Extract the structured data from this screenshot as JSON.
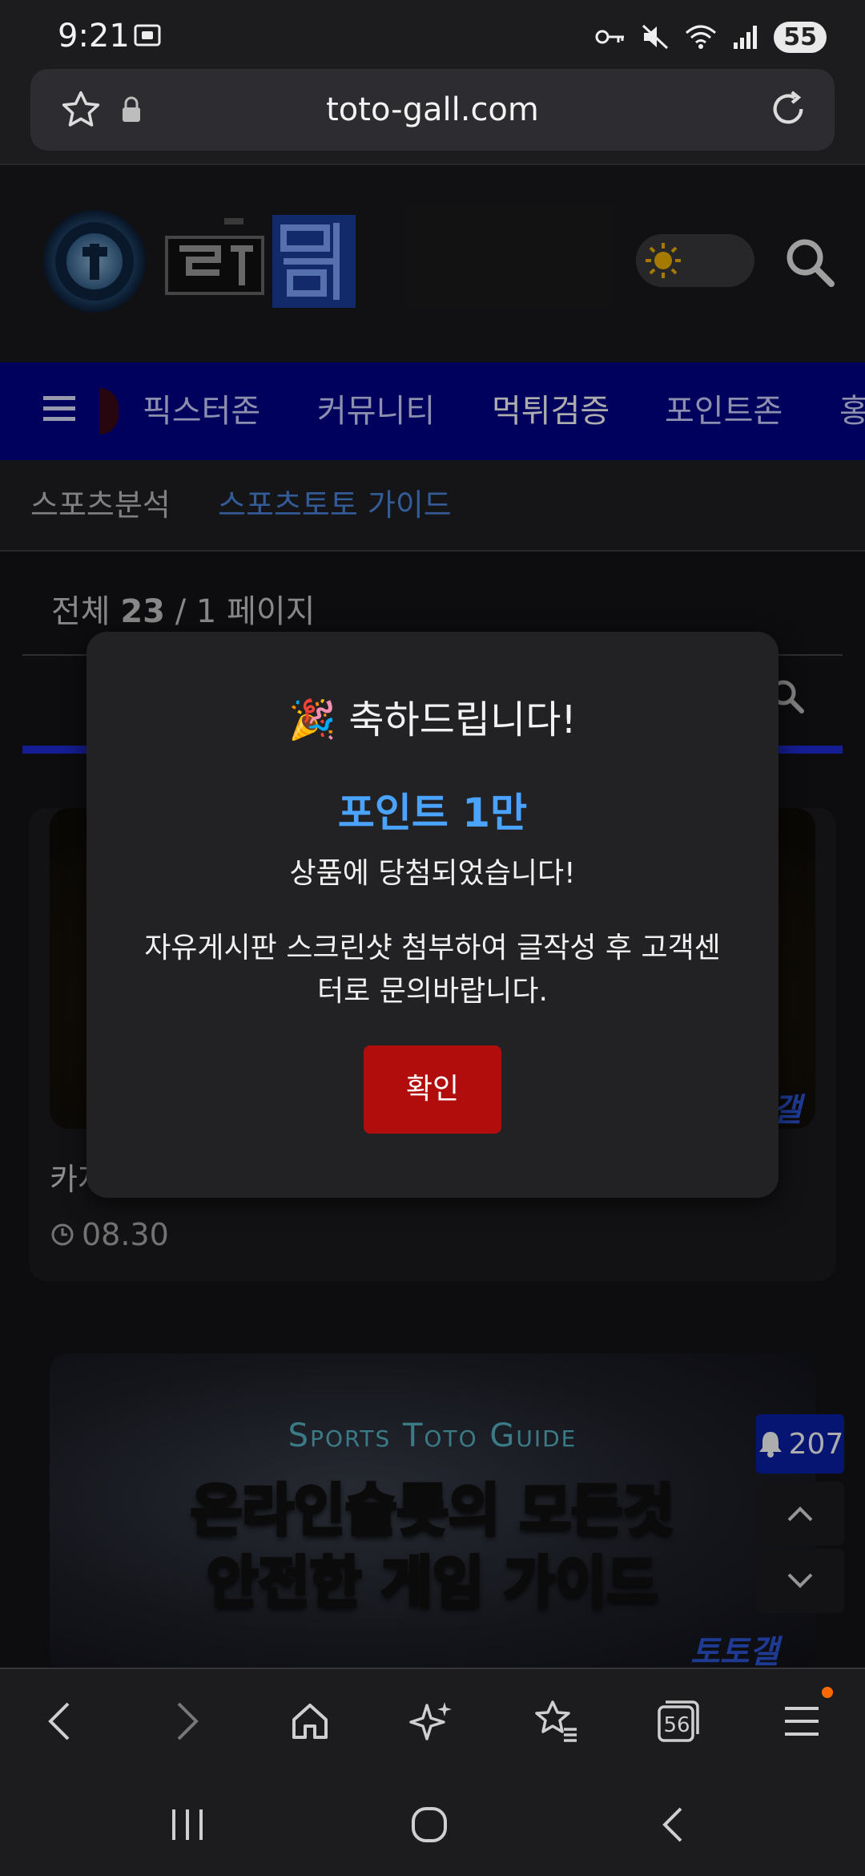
{
  "status_bar": {
    "time": "9:21",
    "battery": "55",
    "icons": [
      "screen-recorder-icon",
      "key-icon",
      "mute-icon",
      "wifi-icon",
      "signal-icon",
      "battery-icon"
    ]
  },
  "browser": {
    "url": "toto-gall.com",
    "tab_count": "56"
  },
  "site": {
    "nav_items": [
      "픽스터존",
      "커뮤니티",
      "먹튀검증",
      "포인트존",
      "홍"
    ],
    "subnav_items": [
      "스포츠분석",
      "스포츠토토 가이드"
    ],
    "count_label": "전체",
    "count_value": "23",
    "count_sep": "/",
    "page_label": "1 페이지",
    "card1_title": "카지",
    "card1_date": "08.30",
    "card1_logo": "갤",
    "card2_subtitle": "Sports Toto Guide",
    "card2_line1": "온라인슬롯의 모든것",
    "card2_line2": "안전한 게임 가이드",
    "card2_logo": "토토갤",
    "bell_count": "207"
  },
  "modal": {
    "emoji": "🎉",
    "title": "축하드립니다!",
    "prize": "포인트 1만",
    "line1": "상품에 당첨되었습니다!",
    "line2": "자유게시판 스크린샷 첨부하여 글작성 후 고객센터로 문의바랍니다.",
    "ok_label": "확인"
  },
  "colors": {
    "nav_bg": "#00008a",
    "prize": "#4aa3ff",
    "ok_button": "#b20d0d",
    "active_subnav": "#4c87e0"
  }
}
